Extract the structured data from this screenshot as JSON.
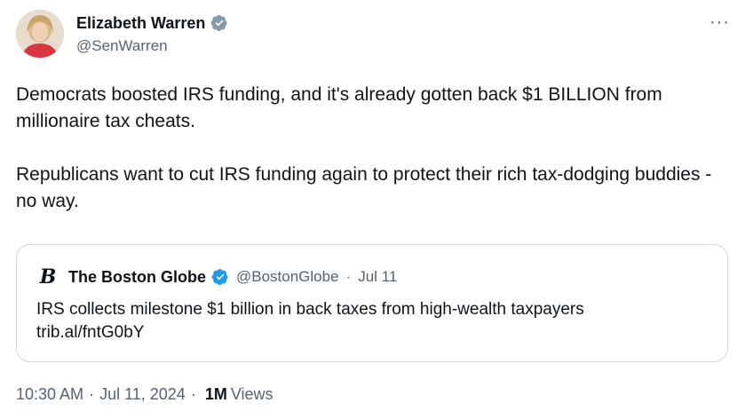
{
  "author": {
    "display_name": "Elizabeth Warren",
    "handle": "@SenWarren",
    "verified_badge": "gray-verified-check"
  },
  "more_button": {
    "label": "···",
    "icon": "more-horizontal-icon"
  },
  "tweet": {
    "paragraphs": [
      "Democrats boosted IRS funding, and it's already gotten back $1 BILLION from millionaire tax cheats.",
      "Republicans want to cut IRS funding again to protect their rich tax-dodging buddies - no way."
    ]
  },
  "quoted_tweet": {
    "logo_text": "B",
    "display_name": "The Boston Globe",
    "verified_badge": "blue-verified-check",
    "handle": "@BostonGlobe",
    "separator": "·",
    "date": "Jul 11",
    "text_line1": "IRS collects milestone $1 billion in back taxes from high-wealth taxpayers",
    "text_line2": "trib.al/fntG0bY"
  },
  "footer": {
    "time": "10:30 AM",
    "separator": "·",
    "date": "Jul 11, 2024",
    "views_count": "1M",
    "views_label": "Views"
  },
  "colors": {
    "text_primary": "#0f1419",
    "text_secondary": "#536471",
    "border": "#cfd9de",
    "verified_blue": "#1d9bf0",
    "verified_gray": "#829aab"
  }
}
